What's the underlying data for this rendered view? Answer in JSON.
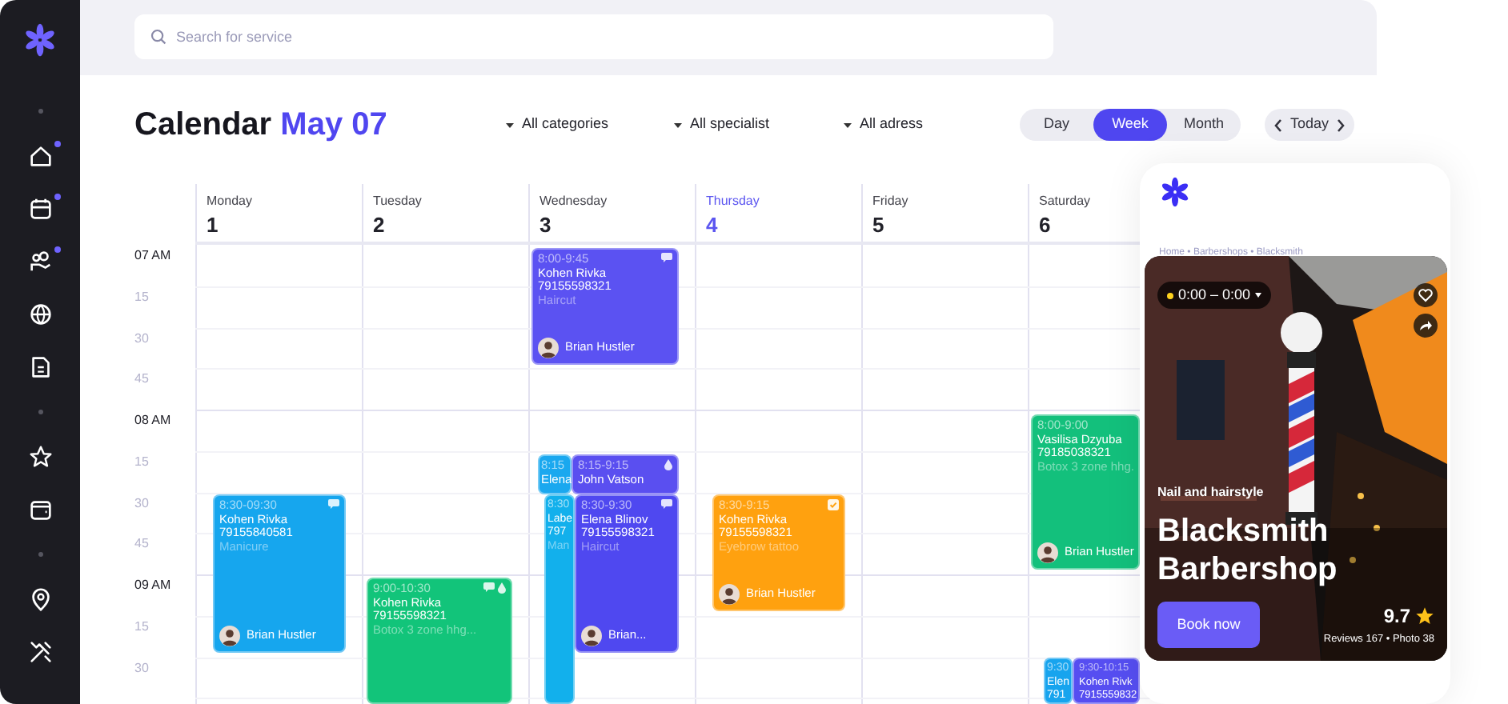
{
  "sidebar": {
    "groups": [
      [
        {
          "kind": "home",
          "dot": true
        },
        {
          "kind": "calendar",
          "dot": true
        },
        {
          "kind": "people",
          "dot": true
        },
        {
          "kind": "globe",
          "dot": false
        },
        {
          "kind": "document",
          "dot": false
        }
      ],
      [
        {
          "kind": "star",
          "dot": false
        },
        {
          "kind": "wallet",
          "dot": false
        }
      ],
      [
        {
          "kind": "pin",
          "dot": false
        },
        {
          "kind": "tools",
          "dot": false
        }
      ]
    ]
  },
  "search": {
    "placeholder": "Search for service"
  },
  "header": {
    "title": "Calendar",
    "date": "May 07"
  },
  "filters": [
    "All categories",
    "All specialist",
    "All adress"
  ],
  "views": [
    {
      "label": "Day",
      "selected": false
    },
    {
      "label": "Week",
      "selected": true
    },
    {
      "label": "Month",
      "selected": false
    }
  ],
  "navigator": {
    "label": "Today"
  },
  "days": [
    {
      "name": "Monday",
      "date": "1",
      "selected": false
    },
    {
      "name": "Tuesday",
      "date": "2",
      "selected": false
    },
    {
      "name": "Wednesday",
      "date": "3",
      "selected": false
    },
    {
      "name": "Thursday",
      "date": "4",
      "selected": true
    },
    {
      "name": "Friday",
      "date": "5",
      "selected": false
    },
    {
      "name": "Saturday",
      "date": "6",
      "selected": false
    }
  ],
  "time_labels": [
    {
      "text": "07 AM",
      "kind": "hour"
    },
    {
      "text": "15",
      "kind": "quarter"
    },
    {
      "text": "30",
      "kind": "quarter"
    },
    {
      "text": "45",
      "kind": "quarter"
    },
    {
      "text": "08 AM",
      "kind": "hour"
    },
    {
      "text": "15",
      "kind": "quarter"
    },
    {
      "text": "30",
      "kind": "quarter"
    },
    {
      "text": "45",
      "kind": "quarter"
    },
    {
      "text": "09 AM",
      "kind": "hour"
    },
    {
      "text": "15",
      "kind": "quarter"
    },
    {
      "text": "30",
      "kind": "quarter"
    }
  ],
  "events": [
    {
      "time": "8:30-09:30",
      "name": "Kohen Rivka",
      "phone": "79155840581",
      "service": "Manicure",
      "specialist": "Brian Hustler",
      "color": "#16a6ee",
      "chat": true,
      "drop": false,
      "check": false
    },
    {
      "time": "9:00-10:30",
      "name": "Kohen Rivka",
      "phone": "79155598321",
      "service": "Botox 3 zone hhg...",
      "color": "#12c47a",
      "chat": true,
      "drop": true,
      "check": false
    },
    {
      "time": "8:00-9:45",
      "name": "Kohen Rivka",
      "phone": "79155598321",
      "service": "Haircut",
      "specialist": "Brian Hustler",
      "color": "#5b52f2",
      "chat": true,
      "drop": false,
      "check": false
    },
    {
      "time": "8:15",
      "name": "Elena",
      "color": "#1aa8ef",
      "chat": false,
      "drop": false,
      "check": false
    },
    {
      "time": "8:30",
      "name": "Labe",
      "phone": "797",
      "service": "Man",
      "color": "#12b0ec",
      "chat": false,
      "drop": false,
      "check": false
    },
    {
      "time": "8:15-9:15",
      "name": "John Vatson",
      "color": "#5a4ff0",
      "chat": false,
      "drop": true,
      "check": false
    },
    {
      "time": "8:30-9:30",
      "name": "Elena Blinov",
      "phone": "79155598321",
      "service": "Haircut",
      "specialist": "Brian...",
      "color": "#4f48f0",
      "chat": true,
      "drop": false,
      "check": false
    },
    {
      "time": "8:30-9:15",
      "name": "Kohen Rivka",
      "phone": "79155598321",
      "service": "Eyebrow tattoo",
      "specialist": "Brian Hustler",
      "color": "#ffa10f",
      "chat": false,
      "drop": false,
      "check": true
    },
    {
      "time": "8:00-9:00",
      "name": "Vasilisa Dzyuba",
      "phone": "79185038321",
      "service": "Botox 3 zone hhg.",
      "specialist": "Brian Hustler",
      "color": "#13c07c",
      "chat": false,
      "drop": false,
      "check": false
    },
    {
      "time": "9:30",
      "name": "Elen",
      "phone": "791",
      "color": "#17a4ee",
      "chat": false,
      "drop": false,
      "check": false
    },
    {
      "time": "9:30-10:15",
      "name": "Kohen Rivk",
      "phone": "7915559832",
      "color": "#564ef1",
      "chat": false,
      "drop": false,
      "check": false
    }
  ],
  "shop_card": {
    "breadcrumb": "Home • Barbershops • Blacksmith",
    "hours": "0:00 – 0:00",
    "category": "Nail and hairstyle",
    "title": "Blacksmith Barbershop",
    "button": "Book now",
    "rating": "9.7",
    "stats": "Reviews 167 • Photo 38"
  }
}
